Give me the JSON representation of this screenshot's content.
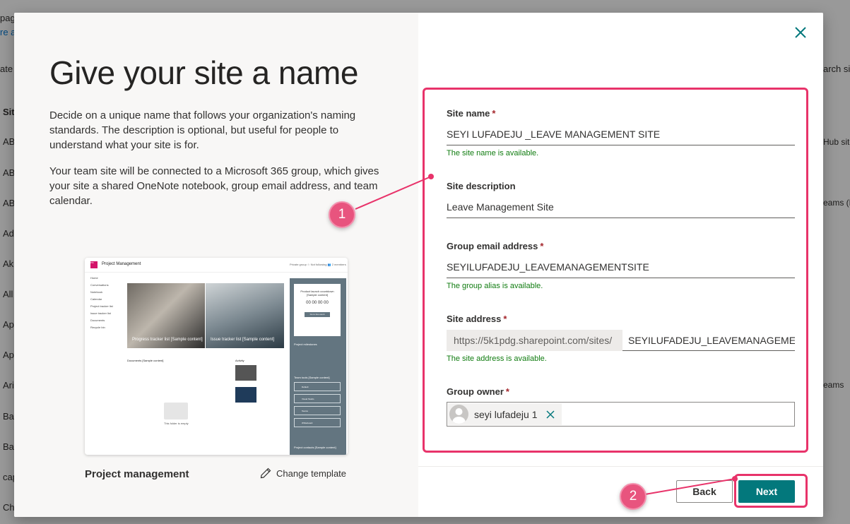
{
  "background": {
    "fragments": [
      "pag",
      "re a",
      "ate",
      "Sit",
      "AB",
      "AB",
      "AB",
      "Ad",
      "Ak",
      "All",
      "Ap",
      "Ap",
      "Ari",
      "Ba",
      "Ba",
      "cap",
      "Ch",
      "arch sit",
      "Hub site",
      "eams (H",
      "eams"
    ]
  },
  "dialog": {
    "title": "Give your site a name",
    "description_1": "Decide on a unique name that follows your organization's naming standards. The description is optional, but useful for people to understand what your site is for.",
    "description_2": "Your team site will be connected to a Microsoft 365 group, which gives your site a shared OneNote notebook, group email address, and team calendar.",
    "template": {
      "name": "Project management",
      "change_label": "Change template",
      "preview": {
        "logo": "PM",
        "site_name": "Project Management",
        "top_right": "Private group   ☆ Not following   👥 2 members",
        "nav": [
          "Home",
          "Conversations",
          "Notebook",
          "Calendar",
          "Project tracker list",
          "Issue tracker list",
          "Documents",
          "Recycle bin"
        ],
        "hero_1": "Progress tracker list [Sample content]",
        "hero_2": "Issue tracker list [Sample content]",
        "countdown_title": "Product launch countdown [Sample content]",
        "countdown_digits": "00  00  00  00",
        "countdown_btn": "Go to live event",
        "milestones": "Project milestones",
        "team_tools": "Team tools [Sample content]",
        "tools": [
          "Default",
          "Visual Studio",
          "Teams",
          "Whiteboard"
        ],
        "contacts": "Project contacts [Sample content]",
        "documents": "Documents [Sample content]",
        "activity": "Activity",
        "empty_folder": "This folder is empty"
      }
    },
    "form": {
      "site_name": {
        "label": "Site name",
        "required": "*",
        "value": "SEYI LUFADEJU _LEAVE MANAGEMENT SITE",
        "message": "The site name is available."
      },
      "site_description": {
        "label": "Site description",
        "value": "Leave Management Site"
      },
      "group_email": {
        "label": "Group email address",
        "required": "*",
        "value": "SEYILUFADEJU_LEAVEMANAGEMENTSITE",
        "message": "The group alias is available."
      },
      "site_address": {
        "label": "Site address",
        "required": "*",
        "prefix": "https://5k1pdg.sharepoint.com/sites/",
        "value": "SEYILUFADEJU_LEAVEMANAGEME   ...",
        "message": "The site address is available."
      },
      "group_owner": {
        "label": "Group owner",
        "required": "*",
        "owner_name": "seyi lufadeju 1"
      }
    },
    "buttons": {
      "back": "Back",
      "next": "Next"
    }
  },
  "annotations": {
    "marker_1": "1",
    "marker_2": "2",
    "color": "#e8336a"
  },
  "colors": {
    "accent": "#03787c",
    "success": "#107c10",
    "required": "#a4262c"
  }
}
